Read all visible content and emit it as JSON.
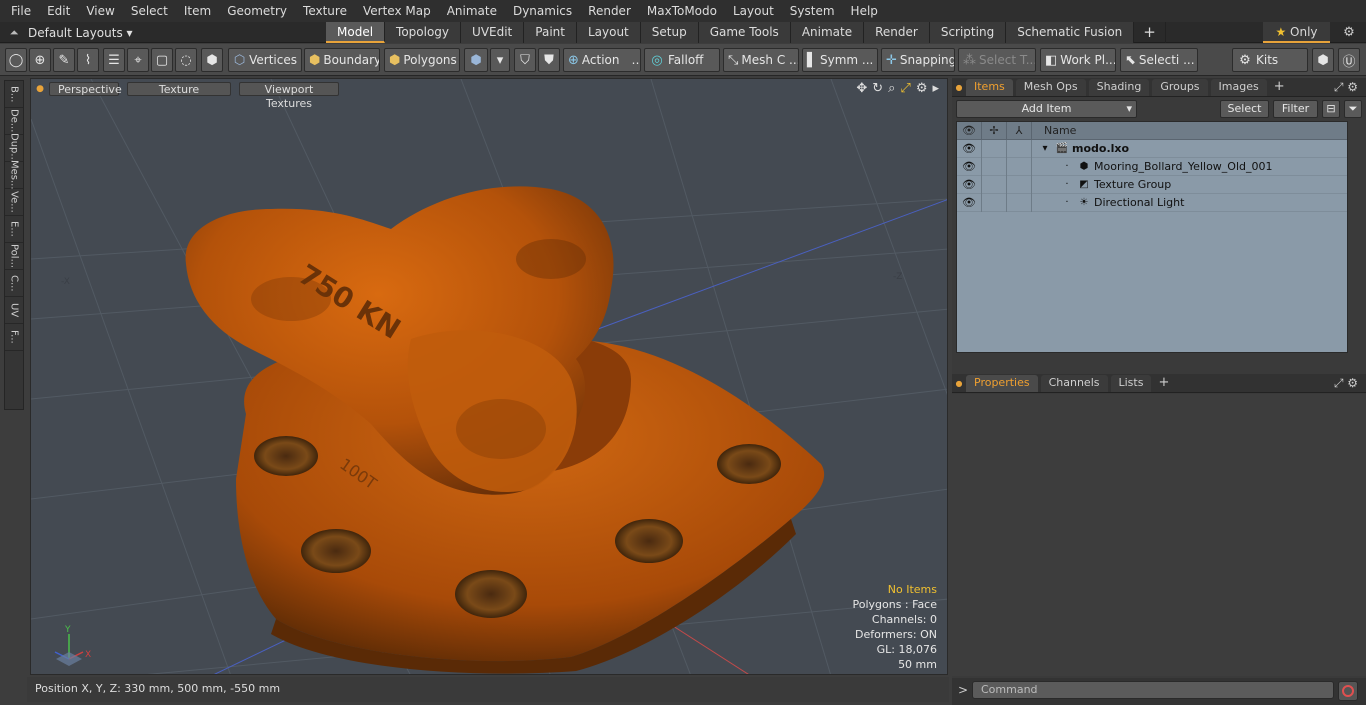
{
  "menu": [
    "File",
    "Edit",
    "View",
    "Select",
    "Item",
    "Geometry",
    "Texture",
    "Vertex Map",
    "Animate",
    "Dynamics",
    "Render",
    "MaxToModo",
    "Layout",
    "System",
    "Help"
  ],
  "layout_bar": {
    "layout_select": "Default Layouts ▾",
    "tabs": [
      {
        "label": "Model",
        "active": true
      },
      {
        "label": "Topology"
      },
      {
        "label": "UVEdit"
      },
      {
        "label": "Paint"
      },
      {
        "label": "Layout"
      },
      {
        "label": "Setup"
      },
      {
        "label": "Game Tools"
      },
      {
        "label": "Animate"
      },
      {
        "label": "Render"
      },
      {
        "label": "Scripting"
      },
      {
        "label": "Schematic Fusion"
      }
    ],
    "add_tab": "+",
    "only_label": "Only",
    "only_icon": "★"
  },
  "toolbar": {
    "vertices": "Vertices",
    "boundary": "Boundary",
    "polygons": "Polygons",
    "action": "Action",
    "falloff": "Falloff",
    "mesh_c": "Mesh C ...",
    "symm": "Symm ...",
    "snapping": "Snapping",
    "select_t": "Select T...",
    "work_pl": "Work Pl...",
    "selecti": "Selecti ...",
    "kits": "Kits"
  },
  "left_tabs": [
    "B...",
    "De...",
    "Dup...",
    "Mes...",
    "Ve...",
    "E...",
    "Pol...",
    "C...",
    "UV",
    "F..."
  ],
  "viewport": {
    "view_mode": "Perspective",
    "shading": "Texture",
    "textures": "Viewport Textures",
    "engraving_top": "750 KN",
    "engraving_base": "100T",
    "axis_x": "X",
    "axis_y": "Y",
    "axis_z_label": "-Z",
    "axis_x_label": "-X",
    "hud": {
      "items": "No Items",
      "polygons": "Polygons : Face",
      "channels": "Channels: 0",
      "deformers": "Deformers: ON",
      "gl": "GL: 18,076",
      "scale": "50 mm"
    }
  },
  "status": {
    "position": "Position X, Y, Z:   330 mm, 500 mm, -550 mm"
  },
  "items_panel": {
    "tabs": [
      {
        "label": "Items",
        "active": true
      },
      {
        "label": "Mesh Ops"
      },
      {
        "label": "Shading"
      },
      {
        "label": "Groups"
      },
      {
        "label": "Images"
      }
    ],
    "add_item": "Add Item",
    "select": "Select",
    "filter": "Filter",
    "name_header": "Name",
    "rows": [
      {
        "label": "modo.lxo",
        "icon": "🎬",
        "indent": 0,
        "bold": true
      },
      {
        "label": "Mooring_Bollard_Yellow_Old_001",
        "icon": "⬢",
        "indent": 1
      },
      {
        "label": "Texture Group",
        "icon": "◩",
        "indent": 1
      },
      {
        "label": "Directional Light",
        "icon": "☀",
        "indent": 1
      }
    ]
  },
  "properties_panel": {
    "tabs": [
      {
        "label": "Properties",
        "active": true
      },
      {
        "label": "Channels"
      },
      {
        "label": "Lists"
      }
    ]
  },
  "command": {
    "prompt": ">",
    "placeholder": "Command"
  }
}
